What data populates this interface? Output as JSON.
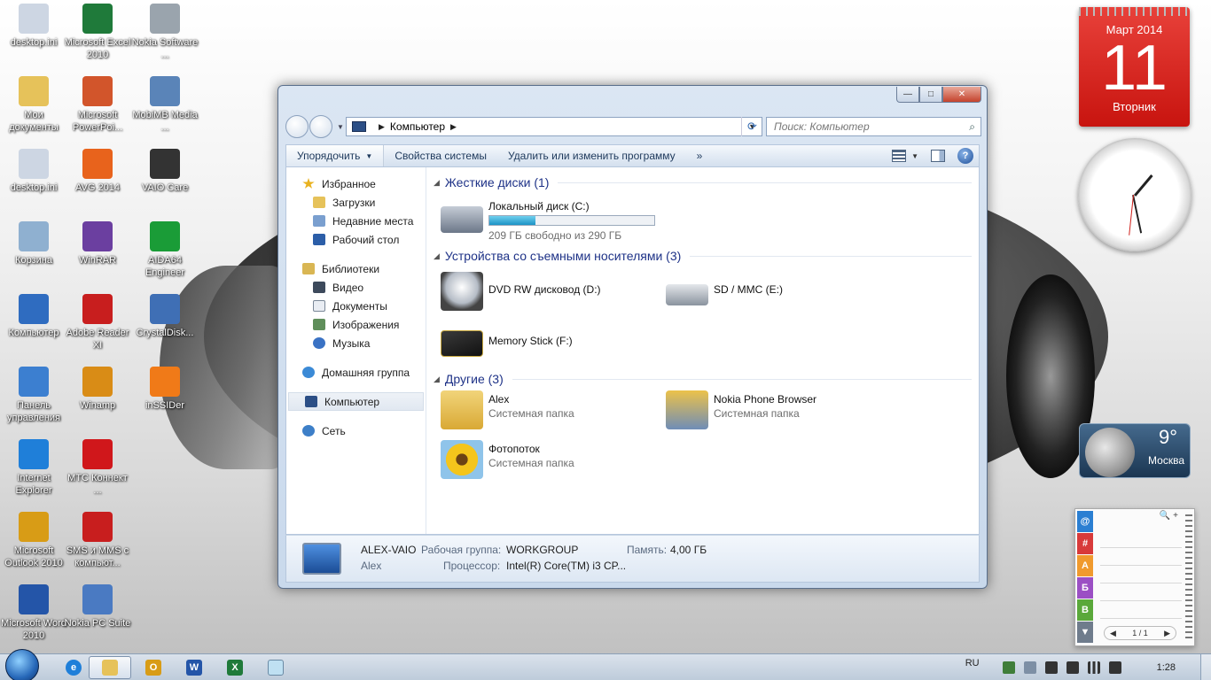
{
  "desktop": {
    "icons": [
      {
        "label": "desktop.ini",
        "icon": "settings-file-icon",
        "color": "#cdd6e3"
      },
      {
        "label": "Microsoft Excel 2010",
        "icon": "excel-icon",
        "color": "#1f7a3a"
      },
      {
        "label": "Nokia Software ...",
        "icon": "nokia-software-icon",
        "color": "#9aa4ad"
      },
      {
        "label": "Мои документы",
        "icon": "folder-icon",
        "color": "#e6c25a"
      },
      {
        "label": "Microsoft PowerPoi...",
        "icon": "powerpoint-icon",
        "color": "#d2552b"
      },
      {
        "label": "MobiMB Media ...",
        "icon": "mobimb-icon",
        "color": "#5a84b8"
      },
      {
        "label": "desktop.ini",
        "icon": "settings-file-icon",
        "color": "#cdd6e3"
      },
      {
        "label": "AVG 2014",
        "icon": "avg-icon",
        "color": "#e8631c"
      },
      {
        "label": "VAIO Care",
        "icon": "vaio-care-icon",
        "color": "#333333"
      },
      {
        "label": "Корзина",
        "icon": "recycle-bin-icon",
        "color": "#8fb0d0"
      },
      {
        "label": "WinRAR",
        "icon": "winrar-icon",
        "color": "#6b3fa0"
      },
      {
        "label": "AIDA64 Engineer",
        "icon": "aida64-icon",
        "color": "#1a9c37"
      },
      {
        "label": "Компьютер",
        "icon": "computer-icon",
        "color": "#2f6cc0"
      },
      {
        "label": "Adobe Reader XI",
        "icon": "adobe-reader-icon",
        "color": "#c81e1e"
      },
      {
        "label": "CrystalDisk...",
        "icon": "crystaldisk-icon",
        "color": "#3f6fb5"
      },
      {
        "label": "Панель управления",
        "icon": "control-panel-icon",
        "color": "#3c7fd0"
      },
      {
        "label": "Winamp",
        "icon": "winamp-icon",
        "color": "#d98c16"
      },
      {
        "label": "inSSIDer",
        "icon": "inssider-icon",
        "color": "#f07a18"
      },
      {
        "label": "Internet Explorer",
        "icon": "internet-explorer-icon",
        "color": "#1f7fd9"
      },
      {
        "label": "МТС Коннект ...",
        "icon": "mts-connect-icon",
        "color": "#d0171b"
      },
      {
        "label": "",
        "icon": "empty",
        "color": "transparent"
      },
      {
        "label": "Microsoft Outlook 2010",
        "icon": "outlook-icon",
        "color": "#d89c16"
      },
      {
        "label": "SMS и MMS с компьют...",
        "icon": "sms-mms-icon",
        "color": "#c81e1e"
      },
      {
        "label": "",
        "icon": "empty",
        "color": "transparent"
      },
      {
        "label": "Microsoft Word 2010",
        "icon": "word-icon",
        "color": "#2455a8"
      },
      {
        "label": "Nokia PC Suite",
        "icon": "nokia-pc-suite-icon",
        "color": "#4a7ac2"
      }
    ]
  },
  "window": {
    "controls": {
      "minimize": "—",
      "maximize": "□",
      "close": "✕"
    },
    "address": {
      "path": "Компьютер"
    },
    "search": {
      "placeholder": "Поиск: Компьютер"
    },
    "commands": {
      "organize": "Упорядочить",
      "system_properties": "Свойства системы",
      "uninstall": "Удалить или изменить программу",
      "more": "»"
    },
    "nav": {
      "favorites": "Избранное",
      "downloads": "Загрузки",
      "recent": "Недавние места",
      "desktop": "Рабочий стол",
      "libraries": "Библиотеки",
      "video": "Видео",
      "documents": "Документы",
      "pictures": "Изображения",
      "music": "Музыка",
      "homegroup": "Домашняя группа",
      "computer": "Компьютер",
      "network": "Сеть"
    },
    "groups": {
      "hdd": "Жесткие диски (1)",
      "removable": "Устройства со съемными носителями (3)",
      "other": "Другие (3)"
    },
    "drives": {
      "c_name": "Локальный диск (C:)",
      "c_free": "209 ГБ свободно из 290 ГБ",
      "c_used_fraction": 0.28,
      "dvd": "DVD RW дисковод (D:)",
      "sd": "SD / MMC (E:)",
      "memstick": "Memory Stick (F:)"
    },
    "others": [
      {
        "name": "Alex",
        "type": "Системная папка"
      },
      {
        "name": "Nokia Phone Browser",
        "type": "Системная папка"
      },
      {
        "name": "Фотопоток",
        "type": "Системная папка"
      }
    ],
    "details": {
      "computer_name": "ALEX-VAIO",
      "user": "Alex",
      "workgroup_label": "Рабочая группа:",
      "workgroup": "WORKGROUP",
      "memory_label": "Память:",
      "memory": "4,00 ГБ",
      "cpu_label": "Процессор:",
      "cpu": "Intel(R) Core(TM) i3 CP..."
    }
  },
  "gadgets": {
    "calendar": {
      "month": "Март 2014",
      "day": "11",
      "weekday": "Вторник"
    },
    "weather": {
      "temp": "9°",
      "city": "Москва"
    },
    "contacts": {
      "tabs": [
        "@",
        "#",
        "А",
        "Б",
        "В",
        "▼"
      ],
      "pager": "1 / 1",
      "prev": "◀",
      "next": "▶",
      "tools": "🔍 +"
    }
  },
  "taskbar": {
    "language": "RU",
    "time": "1:28"
  }
}
